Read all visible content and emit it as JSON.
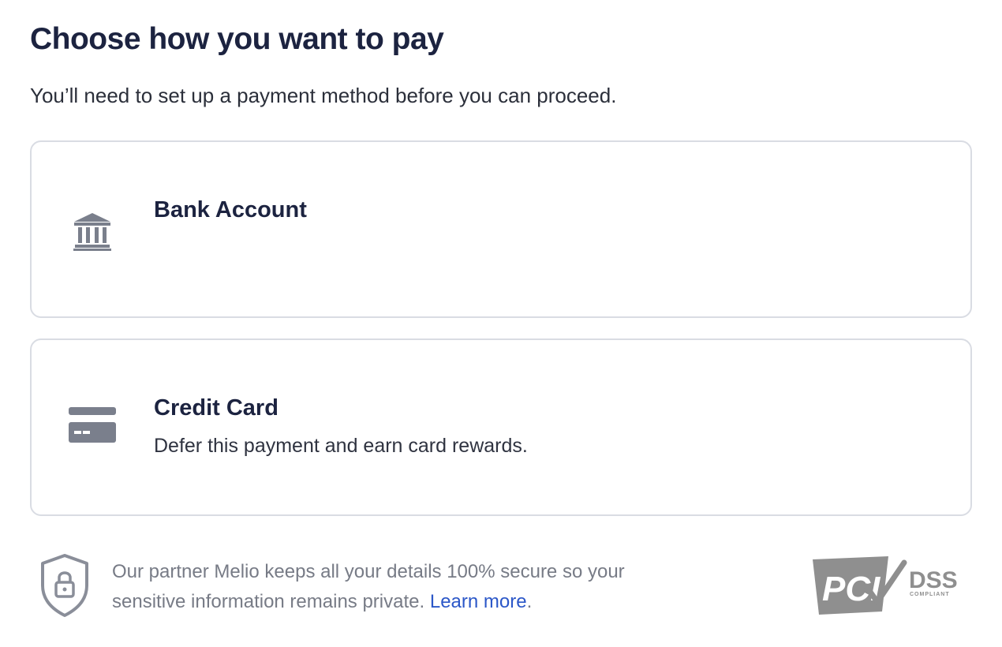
{
  "header": {
    "title": "Choose how you want to pay",
    "subtitle": "You’ll need to set up a payment method before you can proceed."
  },
  "payment_methods": [
    {
      "label": "Bank Account",
      "description": "",
      "icon": "bank-icon"
    },
    {
      "label": "Credit Card",
      "description": "Defer this payment and earn card rewards.",
      "icon": "credit-card-icon"
    }
  ],
  "footer": {
    "security_text": "Our partner Melio keeps all your details 100% secure so your sensitive information remains private.",
    "learn_more": "Learn more",
    "period": ".",
    "shield_icon": "shield-lock-icon",
    "badge": {
      "pci": "PCI",
      "dss": "DSS",
      "compliant": "COMPLIANT"
    }
  },
  "colors": {
    "heading": "#1c2340",
    "icon_gray": "#7a7f8c",
    "border": "#d9dce3",
    "link": "#2b57c8",
    "muted_text": "#777b86"
  }
}
